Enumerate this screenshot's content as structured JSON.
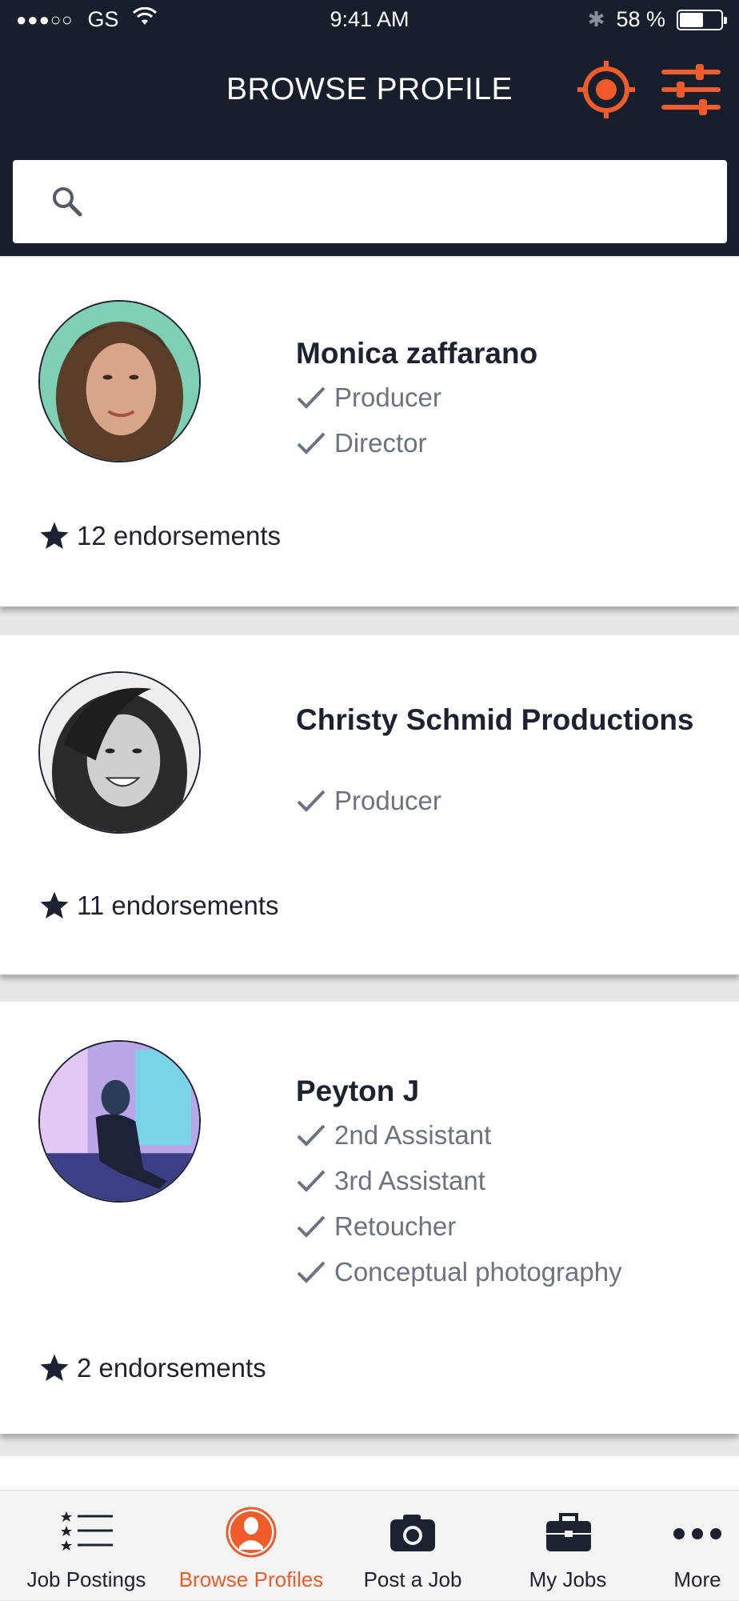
{
  "status_bar": {
    "signal": "●●●○○",
    "carrier": "GS",
    "time": "9:41 AM",
    "battery_percent": "58 %",
    "battery_level": 0.58
  },
  "header": {
    "title": "BROWSE PROFILE",
    "accent_color": "#ef5b2a",
    "background_color": "#181f2c"
  },
  "search": {
    "placeholder": "",
    "value": ""
  },
  "profiles": [
    {
      "name": "Monica zaffarano",
      "roles": [
        "Producer",
        "Director"
      ],
      "endorsements": "12 endorsements"
    },
    {
      "name": "Christy Schmid Productions",
      "roles": [
        "Producer"
      ],
      "endorsements": "11 endorsements"
    },
    {
      "name": "Peyton J",
      "roles": [
        "2nd Assistant",
        "3rd Assistant",
        "Retoucher",
        "Conceptual photography"
      ],
      "endorsements": "2 endorsements"
    }
  ],
  "tabbar": {
    "tabs": [
      {
        "label": "Job Postings",
        "icon": "list-icon",
        "active": false
      },
      {
        "label": "Browse Profiles",
        "icon": "person-icon",
        "active": true
      },
      {
        "label": "Post a Job",
        "icon": "camera-icon",
        "active": false
      },
      {
        "label": "My Jobs",
        "icon": "briefcase-icon",
        "active": false
      },
      {
        "label": "More",
        "icon": "more-icon",
        "active": false
      }
    ]
  }
}
